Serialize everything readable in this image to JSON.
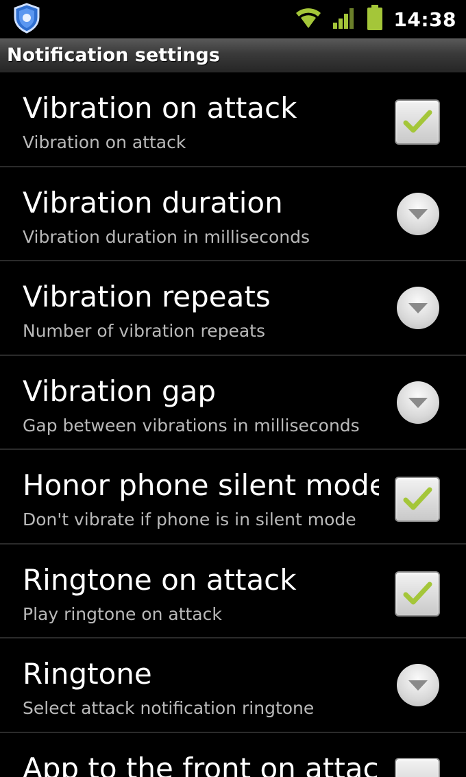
{
  "status_bar": {
    "app_icon": "shield-icon",
    "wifi_icon": "wifi-icon",
    "signal_icon": "signal-icon",
    "battery_icon": "battery-icon",
    "time": "14:38",
    "accent_color": "#a4c639"
  },
  "header": {
    "title": "Notification settings"
  },
  "preferences": [
    {
      "title": "Vibration on attack",
      "summary": "Vibration on attack",
      "widget": "checkbox",
      "checked": true
    },
    {
      "title": "Vibration duration",
      "summary": "Vibration duration in milliseconds",
      "widget": "dropdown"
    },
    {
      "title": "Vibration repeats",
      "summary": "Number of vibration repeats",
      "widget": "dropdown"
    },
    {
      "title": "Vibration gap",
      "summary": "Gap between vibrations in milliseconds",
      "widget": "dropdown"
    },
    {
      "title": "Honor phone silent mode",
      "summary": "Don't vibrate if phone is in silent mode",
      "widget": "checkbox",
      "checked": true
    },
    {
      "title": "Ringtone on attack",
      "summary": "Play ringtone on attack",
      "widget": "checkbox",
      "checked": true
    },
    {
      "title": "Ringtone",
      "summary": "Select attack notification ringtone",
      "widget": "dropdown"
    },
    {
      "title": "App to the front on attack",
      "summary": "",
      "widget": "checkbox",
      "checked": true
    }
  ]
}
